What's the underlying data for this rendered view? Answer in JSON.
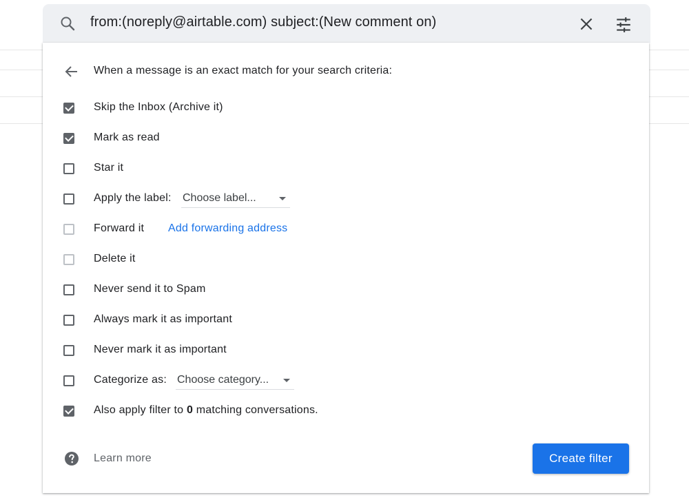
{
  "search": {
    "query": "from:(noreply@airtable.com) subject:(New comment on)",
    "icons": {
      "search": "search-icon",
      "clear": "close-icon",
      "options": "tune-icon"
    }
  },
  "panel": {
    "heading": "When a message is an exact match for your search criteria:",
    "options": [
      {
        "label": "Skip the Inbox (Archive it)",
        "checked": true,
        "enabled": true
      },
      {
        "label": "Mark as read",
        "checked": true,
        "enabled": true
      },
      {
        "label": "Star it",
        "checked": false,
        "enabled": true
      },
      {
        "label": "Apply the label:",
        "checked": false,
        "enabled": true,
        "select_value": "Choose label..."
      },
      {
        "label": "Forward it",
        "checked": false,
        "enabled": false,
        "link": "Add forwarding address"
      },
      {
        "label": "Delete it",
        "checked": false,
        "enabled": false
      },
      {
        "label": "Never send it to Spam",
        "checked": false,
        "enabled": true
      },
      {
        "label": "Always mark it as important",
        "checked": false,
        "enabled": true
      },
      {
        "label": "Never mark it as important",
        "checked": false,
        "enabled": true
      },
      {
        "label": "Categorize as:",
        "checked": false,
        "enabled": true,
        "select_value": "Choose category..."
      },
      {
        "label_prefix": "Also apply filter to ",
        "count": "0",
        "label_suffix": " matching conversations.",
        "checked": true,
        "enabled": true
      }
    ],
    "learn_more": "Learn more",
    "create_button": "Create filter"
  },
  "colors": {
    "accent": "#1a73e8",
    "checkbox": "#5f6368",
    "checkbox_disabled": "#bdc1c6",
    "searchbar_bg": "#eef0f3"
  }
}
